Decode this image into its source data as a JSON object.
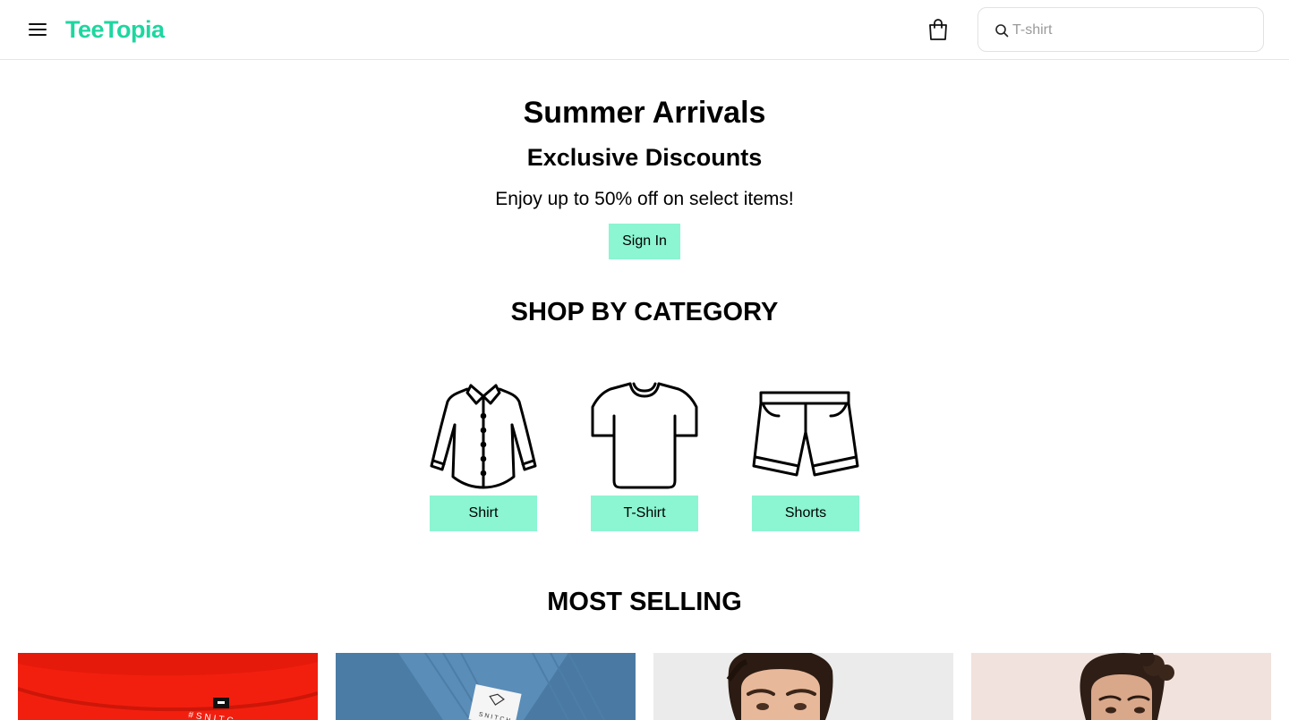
{
  "header": {
    "logo": "TeeTopia",
    "search_placeholder": "T-shirt",
    "menu_icon": "hamburger-menu-icon",
    "cart_icon": "shopping-bag-icon",
    "search_icon": "search-icon"
  },
  "hero": {
    "title": "Summer Arrivals",
    "subtitle": "Exclusive Discounts",
    "text": "Enjoy up to 50% off on select items!",
    "signin_label": "Sign In"
  },
  "categories": {
    "title": "SHOP BY CATEGORY",
    "items": [
      {
        "label": "Shirt",
        "icon": "shirt-icon"
      },
      {
        "label": "T-Shirt",
        "icon": "tshirt-icon"
      },
      {
        "label": "Shorts",
        "icon": "shorts-icon"
      }
    ]
  },
  "most_selling": {
    "title": "MOST SELLING",
    "products": [
      {
        "image": "red-tshirt-image"
      },
      {
        "image": "blue-shirt-image"
      },
      {
        "image": "man-portrait-image"
      },
      {
        "image": "man-curly-hair-image"
      }
    ]
  },
  "colors": {
    "brand": "#1ed6a0",
    "button": "#8cf5d2"
  }
}
